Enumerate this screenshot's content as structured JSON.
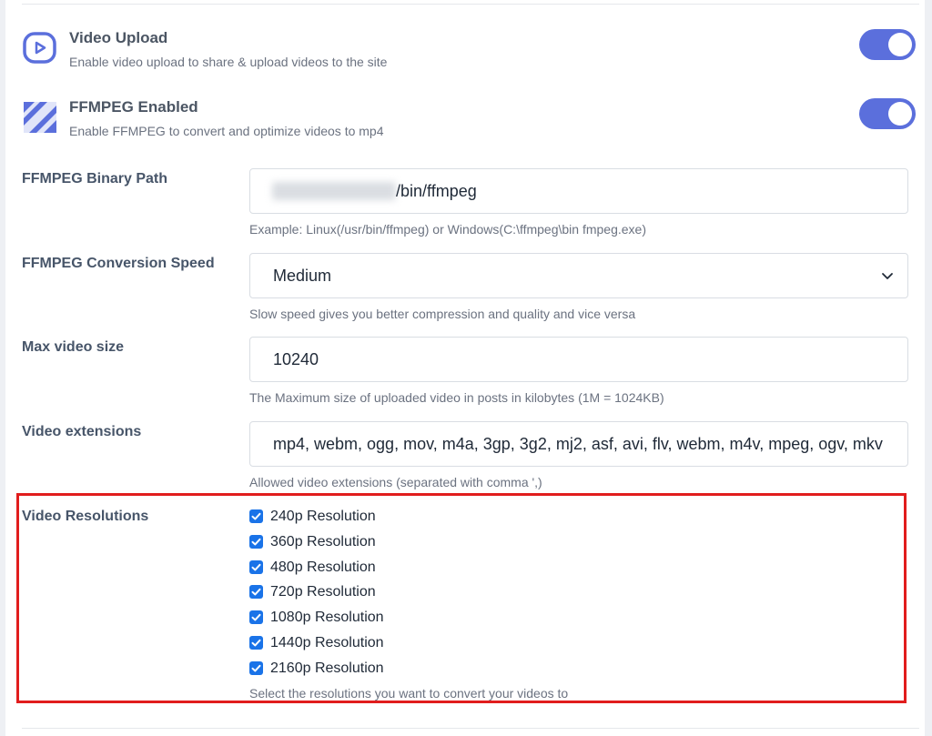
{
  "video_upload": {
    "title": "Video Upload",
    "description": "Enable video upload to share & upload videos to the site",
    "enabled": true
  },
  "ffmpeg": {
    "title": "FFMPEG Enabled",
    "description": "Enable FFMPEG to convert and optimize videos to mp4",
    "enabled": true
  },
  "binary_path": {
    "label": "FFMPEG Binary Path",
    "value_visible_suffix": "/bin/ffmpeg",
    "help": "Example: Linux(/usr/bin/ffmpeg) or Windows(C:\\ffmpeg\\bin fmpeg.exe)"
  },
  "conversion_speed": {
    "label": "FFMPEG Conversion Speed",
    "value": "Medium",
    "help": "Slow speed gives you better compression and quality and vice versa"
  },
  "max_size": {
    "label": "Max video size",
    "value": "10240",
    "help": "The Maximum size of uploaded video in posts in kilobytes (1M = 1024KB)"
  },
  "extensions": {
    "label": "Video extensions",
    "value": "mp4, webm, ogg, mov, m4a, 3gp, 3g2, mj2, asf, avi, flv, webm, m4v, mpeg, ogv, mkv",
    "help": "Allowed video extensions (separated with comma ',)"
  },
  "resolutions": {
    "label": "Video Resolutions",
    "items": [
      {
        "label": "240p Resolution",
        "checked": true
      },
      {
        "label": "360p Resolution",
        "checked": true
      },
      {
        "label": "480p Resolution",
        "checked": true
      },
      {
        "label": "720p Resolution",
        "checked": true
      },
      {
        "label": "1080p Resolution",
        "checked": true
      },
      {
        "label": "1440p Resolution",
        "checked": true
      },
      {
        "label": "2160p Resolution",
        "checked": true
      }
    ],
    "help": "Select the resolutions you want to convert your videos to"
  },
  "colors": {
    "accent": "#5b6fdc",
    "checkbox": "#1a73e8",
    "highlight": "#e11d1d"
  }
}
